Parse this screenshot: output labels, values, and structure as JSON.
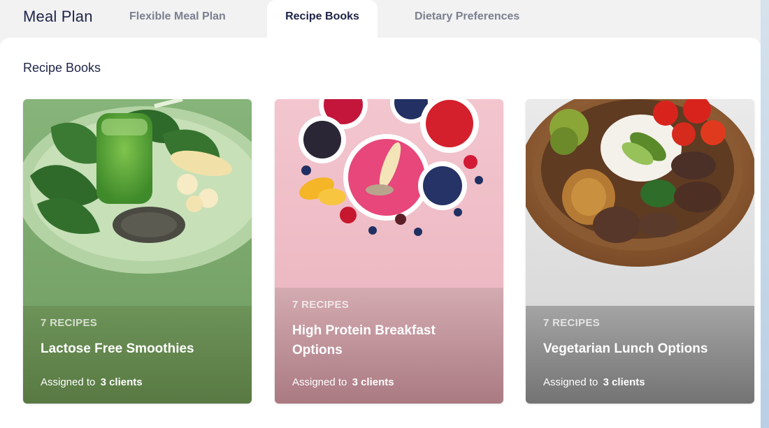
{
  "app": {
    "title": "Meal Plan"
  },
  "tabs": [
    {
      "label": "Flexible Meal Plan",
      "active": false
    },
    {
      "label": "Recipe Books",
      "active": true
    },
    {
      "label": "Dietary Preferences",
      "active": false
    }
  ],
  "section": {
    "title": "Recipe Books"
  },
  "cards": [
    {
      "count": "7 RECIPES",
      "name": "Lactose Free Smoothies",
      "assigned_prefix": "Assigned to",
      "assigned_clients": "3 clients",
      "image": "green-smoothie-spinach-banana-chia-photo"
    },
    {
      "count": "7 RECIPES",
      "name": "High Protein Breakfast Options",
      "assigned_prefix": "Assigned to",
      "assigned_clients": "3 clients",
      "image": "smoothie-bowl-berries-photo"
    },
    {
      "count": "7 RECIPES",
      "name": "Vegetarian Lunch Options",
      "assigned_prefix": "Assigned to",
      "assigned_clients": "3 clients",
      "image": "grilled-vegetable-rice-bowl-photo"
    }
  ]
}
